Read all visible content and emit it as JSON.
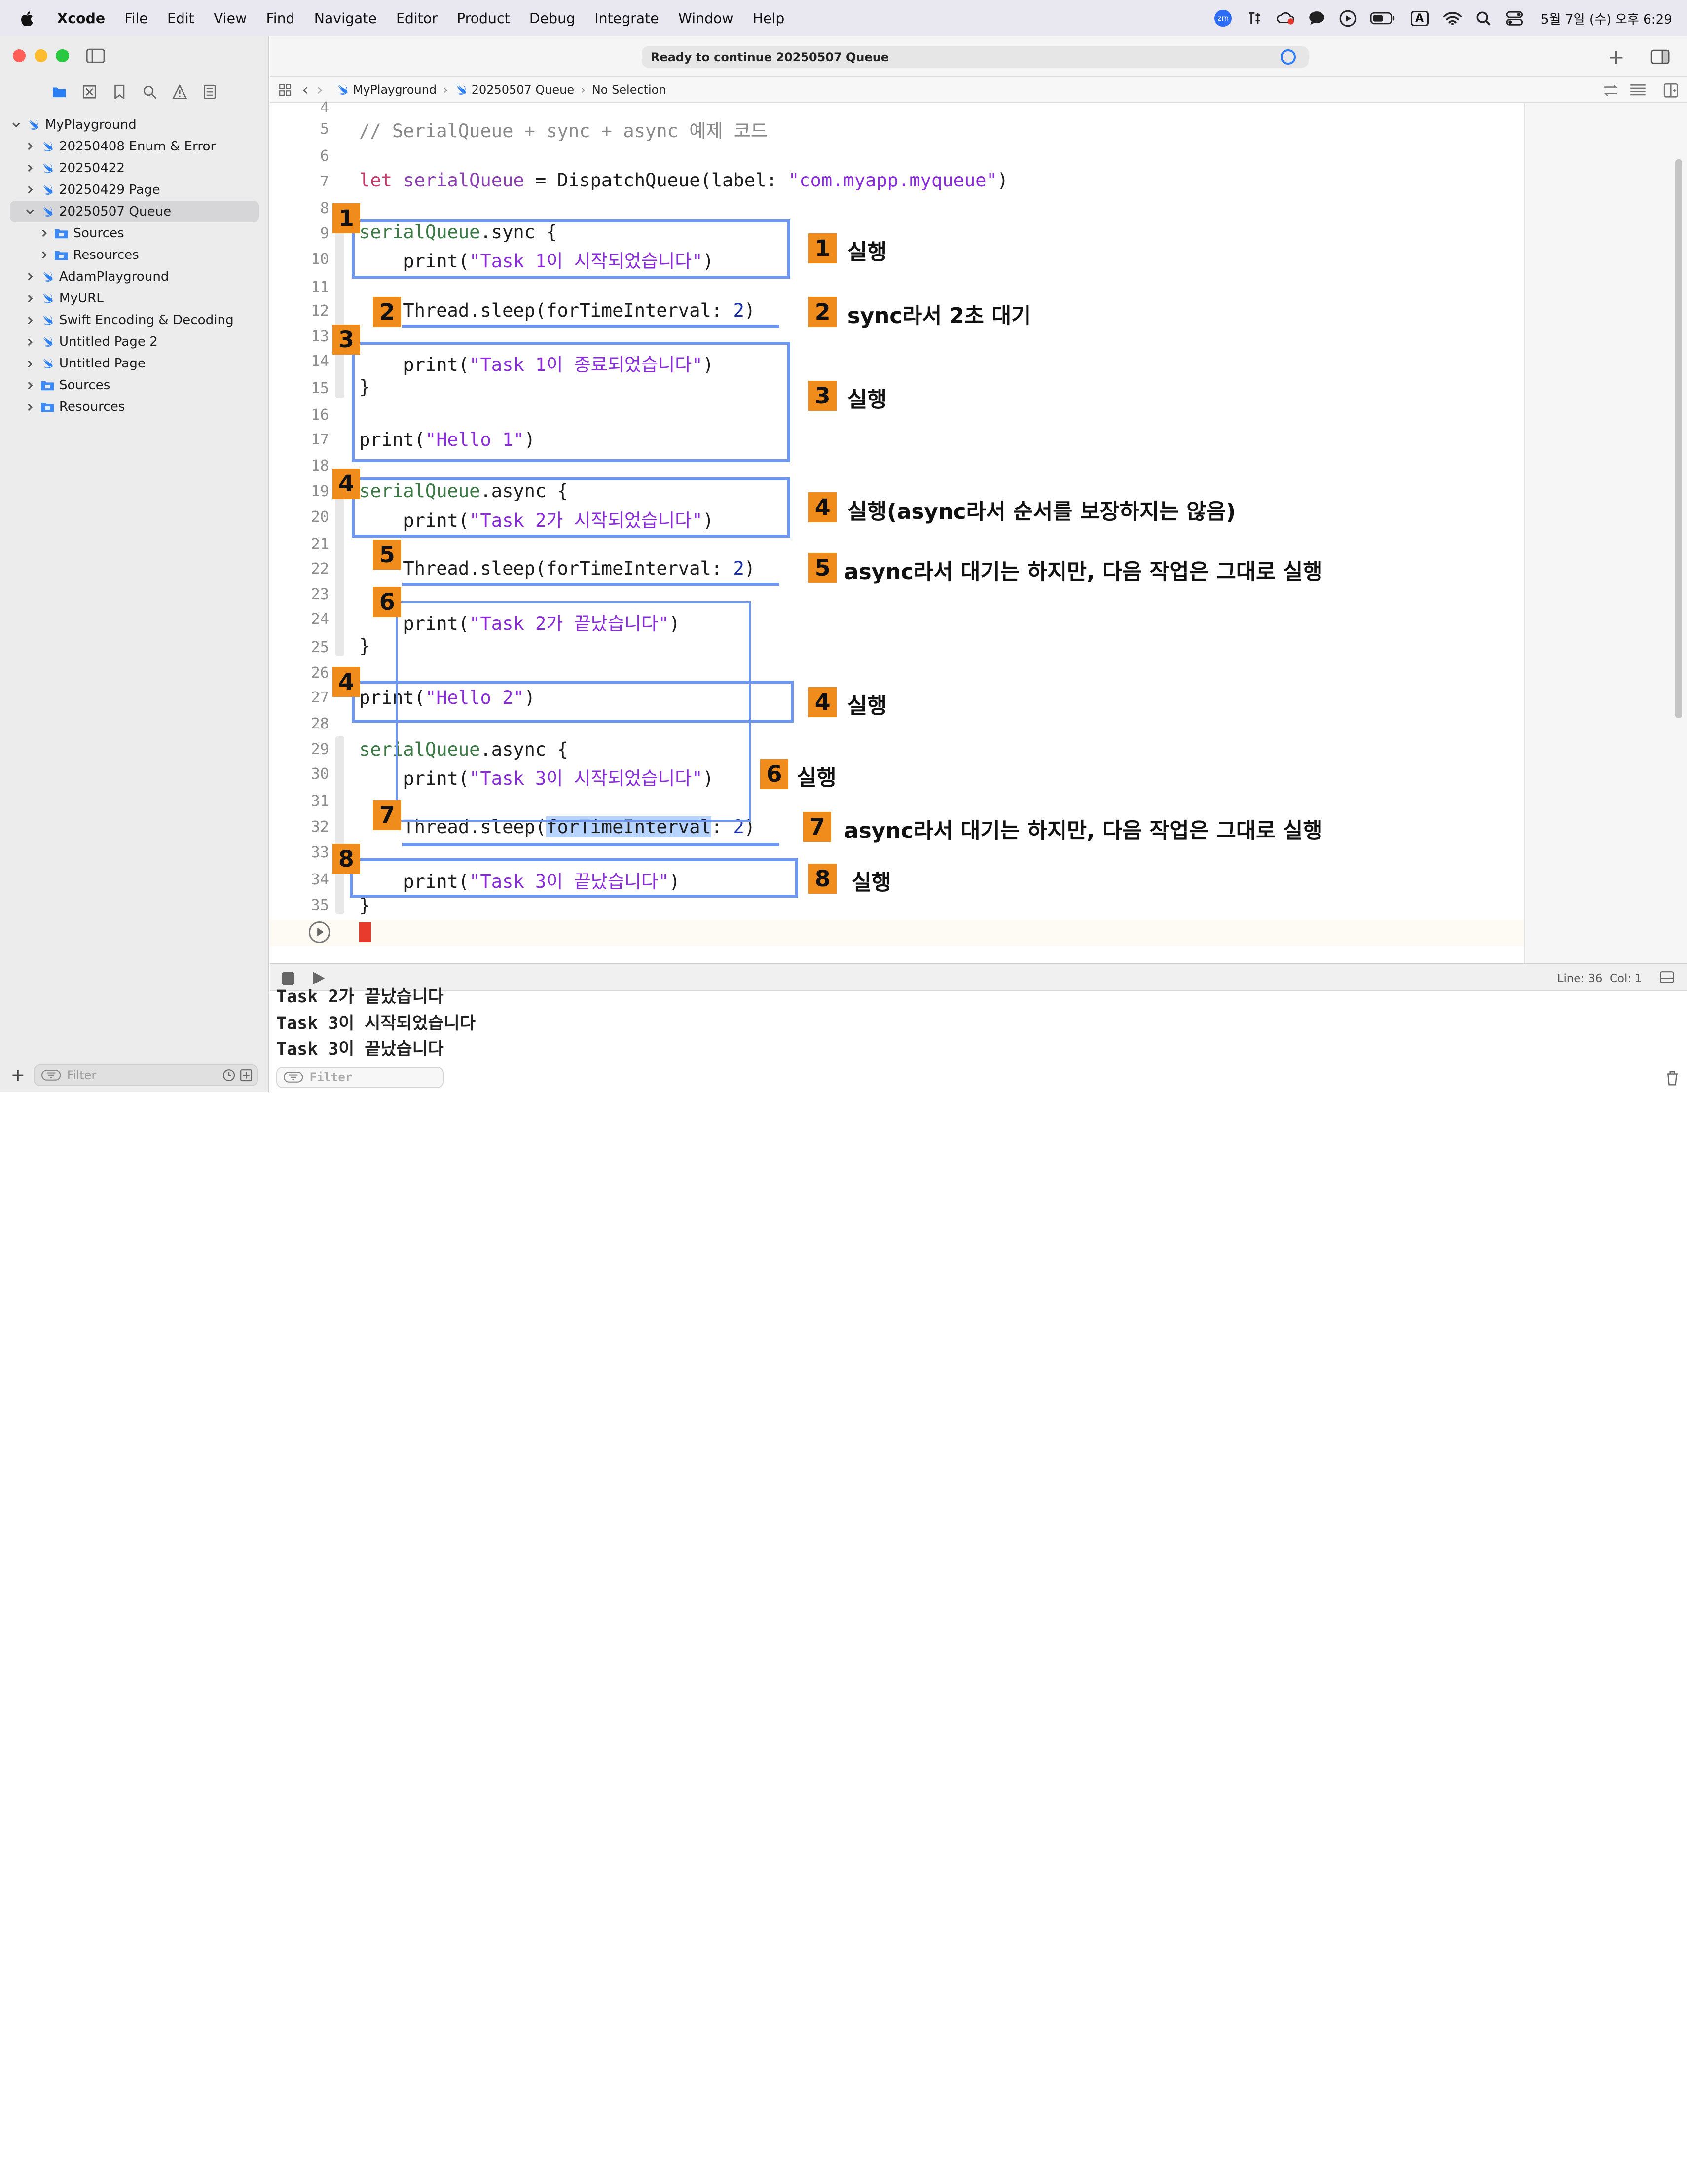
{
  "menubar": {
    "items": [
      "Xcode",
      "File",
      "Edit",
      "View",
      "Find",
      "Navigate",
      "Editor",
      "Product",
      "Debug",
      "Integrate",
      "Window",
      "Help"
    ],
    "clock": "5월 7일 (수) 오후 6:29",
    "zoom_badge": "zm",
    "input_source": "A",
    "icons": [
      "apple-icon",
      "zoom-icon",
      "korean-input-icon",
      "creative-cloud-icon",
      "messages-icon",
      "play-icon",
      "battery-icon",
      "keyboard-input-icon",
      "wifi-icon",
      "search-icon",
      "control-center-icon"
    ]
  },
  "toolbar": {
    "status": "Ready to continue 20250507 Queue"
  },
  "jumpbar": {
    "crumbs": [
      "MyPlayground",
      "20250507 Queue",
      "No Selection"
    ]
  },
  "sidebar": {
    "items": [
      {
        "label": "MyPlayground",
        "icon": "swift-icon",
        "expanded": true,
        "level": 0
      },
      {
        "label": "20250408 Enum & Error",
        "icon": "swift-icon",
        "level": 1
      },
      {
        "label": "20250422",
        "icon": "swift-icon",
        "level": 1
      },
      {
        "label": "20250429 Page",
        "icon": "swift-icon",
        "level": 1
      },
      {
        "label": "20250507 Queue",
        "icon": "swift-icon",
        "expanded": true,
        "selected": true,
        "level": 1
      },
      {
        "label": "Sources",
        "icon": "folder-icon",
        "level": 2
      },
      {
        "label": "Resources",
        "icon": "folder-icon",
        "level": 2
      },
      {
        "label": "AdamPlayground",
        "icon": "swift-icon",
        "level": 1
      },
      {
        "label": "MyURL",
        "icon": "swift-icon",
        "level": 1
      },
      {
        "label": "Swift Encoding & Decoding",
        "icon": "swift-icon",
        "level": 1
      },
      {
        "label": "Untitled Page 2",
        "icon": "swift-icon",
        "level": 1
      },
      {
        "label": "Untitled Page",
        "icon": "swift-icon",
        "level": 1
      },
      {
        "label": "Sources",
        "icon": "folder-icon",
        "level": 1
      },
      {
        "label": "Resources",
        "icon": "folder-icon",
        "level": 1
      }
    ],
    "filter_placeholder": "Filter"
  },
  "editor": {
    "line_numbers": [
      "4",
      "5",
      "6",
      "7",
      "8",
      "9",
      "10",
      "11",
      "12",
      "13",
      "14",
      "15",
      "16",
      "17",
      "18",
      "19",
      "20",
      "21",
      "22",
      "23",
      "24",
      "25",
      "26",
      "27",
      "28",
      "29",
      "30",
      "31",
      "32",
      "33",
      "34",
      "35"
    ],
    "code": {
      "l5": "// SerialQueue + sync + async 예제 코드",
      "l7_kw": "let",
      "l7_var": "serialQueue",
      "l7_mid": " = DispatchQueue(label: ",
      "l7_str": "\"com.myapp.myqueue\"",
      "l7_end": ")",
      "l9_var": "serialQueue",
      "l9_rest": ".sync {",
      "l10_fn": "    print(",
      "l10_str": "\"Task 1이 시작되었습니다\"",
      "l10_end": ")",
      "l12_a": "    Thread.sleep(forTimeInterval: ",
      "l12_num": "2",
      "l12_end": ")",
      "l14_fn": "    print(",
      "l14_str": "\"Task 1이 종료되었습니다\"",
      "l14_end": ")",
      "l15": "}",
      "l17_fn": "print(",
      "l17_str": "\"Hello 1\"",
      "l17_end": ")",
      "l19_var": "serialQueue",
      "l19_rest": ".async {",
      "l20_fn": "    print(",
      "l20_str": "\"Task 2가 시작되었습니다\"",
      "l20_end": ")",
      "l22_a": "    Thread.sleep(forTimeInterval: ",
      "l22_num": "2",
      "l22_end": ")",
      "l24_fn": "    print(",
      "l24_str": "\"Task 2가 끝났습니다\"",
      "l24_end": ")",
      "l25": "}",
      "l27_fn": "print(",
      "l27_str": "\"Hello 2\"",
      "l27_end": ")",
      "l29_var": "serialQueue",
      "l29_rest": ".async {",
      "l30_fn": "    print(",
      "l30_str": "\"Task 3이 시작되었습니다\"",
      "l30_end": ")",
      "l32_a": "    Thread.sleep(",
      "l32_hl": "forTimeInterval",
      "l32_b": ": ",
      "l32_num": "2",
      "l32_end": ")",
      "l34_fn": "    print(",
      "l34_str": "\"Task 3이 끝났습니다\"",
      "l34_end": ")",
      "l35": "}"
    }
  },
  "annotations": {
    "badges": [
      "1",
      "2",
      "3",
      "4",
      "5",
      "6",
      "4",
      "7",
      "8"
    ],
    "notes": [
      {
        "num": "1",
        "text": "실행"
      },
      {
        "num": "2",
        "text": "sync라서 2초 대기"
      },
      {
        "num": "3",
        "text": "실행"
      },
      {
        "num": "4",
        "text": "실행(async라서 순서를 보장하지는 않음)"
      },
      {
        "num": "5",
        "text": "async라서 대기는 하지만, 다음 작업은 그대로 실행"
      },
      {
        "num": "4",
        "text": "실행"
      },
      {
        "num": "6",
        "text": "실행"
      },
      {
        "num": "7",
        "text": "async라서 대기는 하지만, 다음 작업은 그대로 실행"
      },
      {
        "num": "8",
        "text": "실행"
      }
    ],
    "color": "#f08c1c",
    "box_color": "#6f97ef"
  },
  "debug": {
    "position": "Line: 36  Col: 1",
    "console_lines": [
      "Task 2가 끝났습니다",
      "Task 3이 시작되었습니다",
      "Task 3이 끝났습니다"
    ],
    "filter_placeholder": "Filter"
  }
}
